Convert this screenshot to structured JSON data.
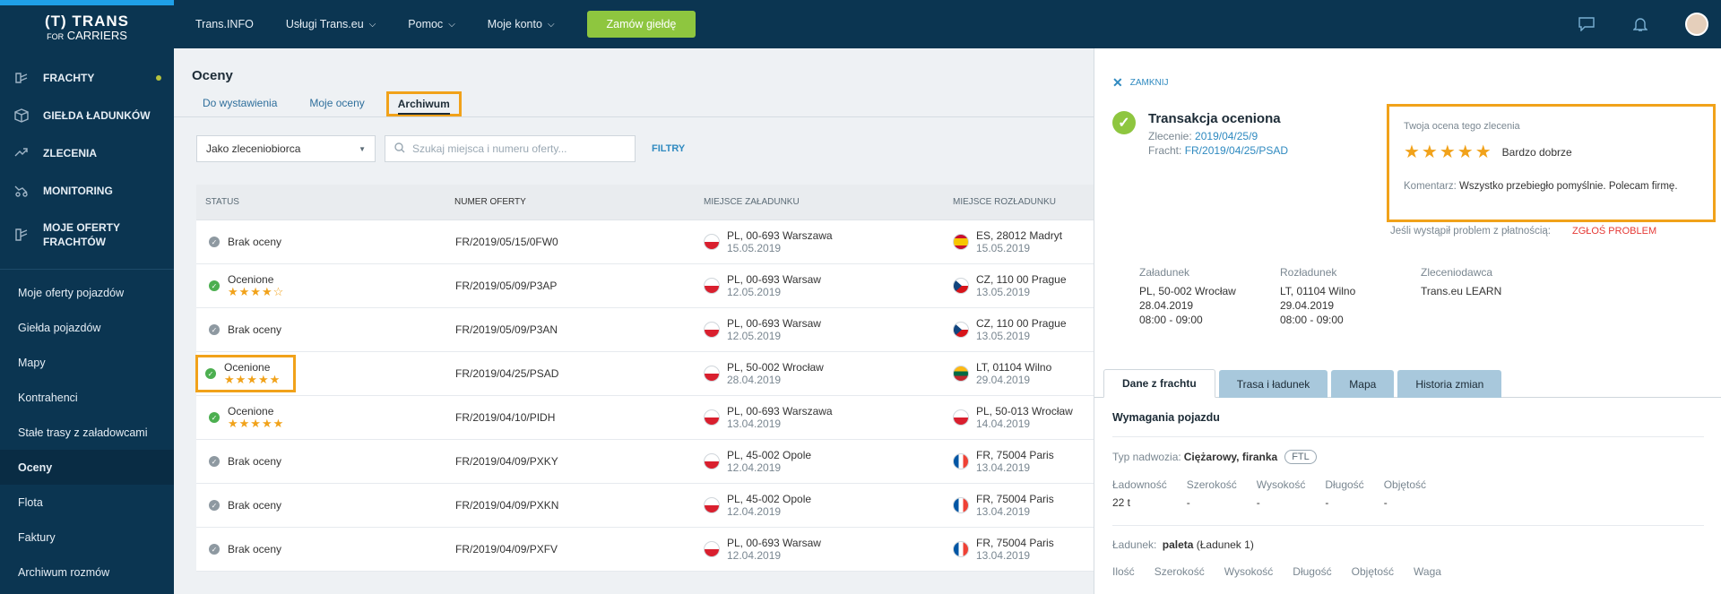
{
  "brand": {
    "line1": "(T) TRANS",
    "line2_prefix": "FOR",
    "line2": "CARRIERS"
  },
  "sidebar": {
    "main": [
      {
        "label": "FRACHTY",
        "icon": "freight-icon",
        "dot": true
      },
      {
        "label": "GIEŁDA ŁADUNKÓW",
        "icon": "box-icon"
      },
      {
        "label": "ZLECENIA",
        "icon": "handshake-icon"
      },
      {
        "label": "MONITORING",
        "icon": "truck-route-icon"
      },
      {
        "label": "MOJE OFERTY FRACHTÓW",
        "icon": "freight-offers-icon"
      }
    ],
    "sub": [
      {
        "label": "Moje oferty pojazdów"
      },
      {
        "label": "Giełda pojazdów"
      },
      {
        "label": "Mapy"
      },
      {
        "label": "Kontrahenci"
      },
      {
        "label": "Stałe trasy z załadowcami"
      },
      {
        "label": "Oceny",
        "active": true
      },
      {
        "label": "Flota"
      },
      {
        "label": "Faktury"
      },
      {
        "label": "Archiwum rozmów"
      }
    ]
  },
  "header": {
    "items": [
      "Trans.INFO",
      "Usługi Trans.eu",
      "Pomoc",
      "Moje konto"
    ],
    "order_button": "Zamów giełdę"
  },
  "page": {
    "title": "Oceny",
    "tabs": [
      "Do wystawienia",
      "Moje oceny",
      "Archiwum"
    ],
    "active_tab": "Archiwum",
    "select_value": "Jako zleceniobiorca",
    "search_placeholder": "Szukaj miejsca i numeru oferty...",
    "filters": "FILTRY"
  },
  "table": {
    "headers": [
      "STATUS",
      "NUMER OFERTY",
      "MIEJSCE ZAŁADUNKU",
      "MIEJSCE ROZŁADUNKU"
    ],
    "rows": [
      {
        "status": "Brak oceny",
        "rated": false,
        "stars": "",
        "offer": "FR/2019/05/15/0FW0",
        "load_flag": "pl",
        "load_city": "PL, 00-693 Warszawa",
        "load_date": "15.05.2019",
        "unload_flag": "es",
        "unload_city": "ES, 28012 Madryt",
        "unload_date": "15.05.2019"
      },
      {
        "status": "Ocenione",
        "rated": true,
        "stars": "★★★★☆",
        "offer": "FR/2019/05/09/P3AP",
        "load_flag": "pl",
        "load_city": "PL, 00-693 Warsaw",
        "load_date": "12.05.2019",
        "unload_flag": "cz",
        "unload_city": "CZ, 110 00 Prague",
        "unload_date": "13.05.2019"
      },
      {
        "status": "Brak oceny",
        "rated": false,
        "stars": "",
        "offer": "FR/2019/05/09/P3AN",
        "load_flag": "pl",
        "load_city": "PL, 00-693 Warsaw",
        "load_date": "12.05.2019",
        "unload_flag": "cz",
        "unload_city": "CZ, 110 00 Prague",
        "unload_date": "13.05.2019"
      },
      {
        "status": "Ocenione",
        "rated": true,
        "stars": "★★★★★",
        "highlight": true,
        "offer": "FR/2019/04/25/PSAD",
        "load_flag": "pl",
        "load_city": "PL, 50-002 Wrocław",
        "load_date": "28.04.2019",
        "unload_flag": "lt",
        "unload_city": "LT, 01104 Wilno",
        "unload_date": "29.04.2019"
      },
      {
        "status": "Ocenione",
        "rated": true,
        "stars": "★★★★★",
        "offer": "FR/2019/04/10/PIDH",
        "load_flag": "pl",
        "load_city": "PL, 00-693 Warszawa",
        "load_date": "13.04.2019",
        "unload_flag": "pl",
        "unload_city": "PL, 50-013 Wrocław",
        "unload_date": "14.04.2019"
      },
      {
        "status": "Brak oceny",
        "rated": false,
        "stars": "",
        "offer": "FR/2019/04/09/PXKY",
        "load_flag": "pl",
        "load_city": "PL, 45-002 Opole",
        "load_date": "12.04.2019",
        "unload_flag": "fr",
        "unload_city": "FR, 75004 Paris",
        "unload_date": "13.04.2019"
      },
      {
        "status": "Brak oceny",
        "rated": false,
        "stars": "",
        "offer": "FR/2019/04/09/PXKN",
        "load_flag": "pl",
        "load_city": "PL, 45-002 Opole",
        "load_date": "12.04.2019",
        "unload_flag": "fr",
        "unload_city": "FR, 75004 Paris",
        "unload_date": "13.04.2019"
      },
      {
        "status": "Brak oceny",
        "rated": false,
        "stars": "",
        "offer": "FR/2019/04/09/PXFV",
        "load_flag": "pl",
        "load_city": "PL, 00-693 Warsaw",
        "load_date": "12.04.2019",
        "unload_flag": "fr",
        "unload_city": "FR, 75004 Paris",
        "unload_date": "13.04.2019"
      }
    ]
  },
  "panel": {
    "close": "ZAMKNIJ",
    "title": "Transakcja oceniona",
    "order_label": "Zlecenie:",
    "order_value": "2019/04/25/9",
    "freight_label": "Fracht:",
    "freight_value": "FR/2019/04/25/PSAD",
    "rating": {
      "title": "Twoja ocena tego zlecenia",
      "stars": "★★★★★",
      "label": "Bardzo dobrze",
      "comment_key": "Komentarz:",
      "comment": "Wszystko przebiegło pomyślnie. Polecam firmę."
    },
    "problem_text": "Jeśli wystąpił problem z płatnością:",
    "problem_link": "ZGŁOŚ PROBLEM",
    "route": {
      "load_label": "Załadunek",
      "load_city": "PL, 50-002 Wrocław",
      "load_date": "28.04.2019",
      "load_time": "08:00 - 09:00",
      "unload_label": "Rozładunek",
      "unload_city": "LT, 01104 Wilno",
      "unload_date": "29.04.2019",
      "unload_time": "08:00 - 09:00",
      "client_label": "Zleceniodawca",
      "client": "Trans.eu LEARN"
    },
    "tabs": [
      "Dane z frachtu",
      "Trasa i ładunek",
      "Mapa",
      "Historia zmian"
    ],
    "details": {
      "section": "Wymagania pojazdu",
      "body_label": "Typ nadwozia:",
      "body_value": "Ciężarowy, firanka",
      "badge": "FTL",
      "vehicle_cols": [
        "Ładowność",
        "Szerokość",
        "Wysokość",
        "Długość",
        "Objętość"
      ],
      "vehicle_vals": [
        "22 t",
        "-",
        "-",
        "-",
        "-"
      ],
      "cargo_label": "Ładunek:",
      "cargo_value": "paleta",
      "cargo_suffix": "(Ładunek 1)",
      "cargo_cols": [
        "Ilość",
        "Szerokość",
        "Wysokość",
        "Długość",
        "Objętość",
        "Waga"
      ]
    }
  },
  "colors": {
    "sidebar": "#0b3551",
    "accent": "#8ec63f",
    "highlight": "#f1a21a",
    "link": "#2f8ac0"
  }
}
